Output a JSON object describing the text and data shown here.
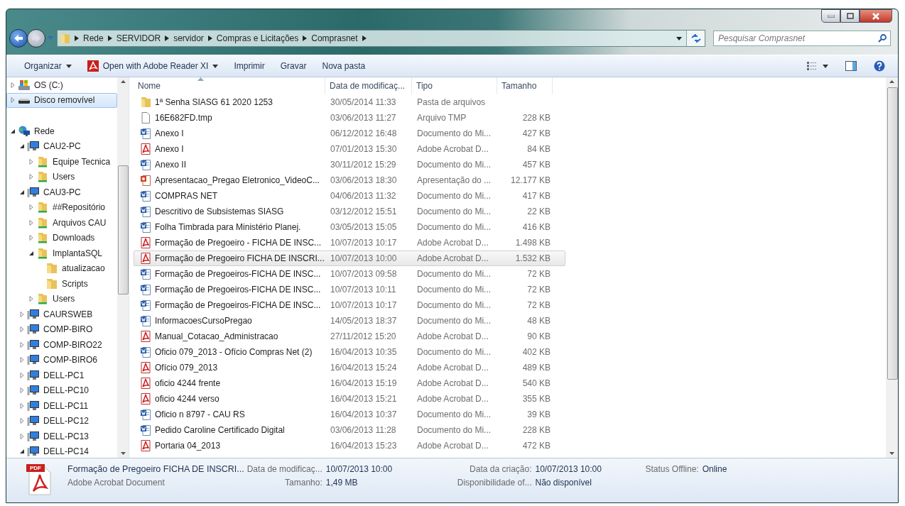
{
  "breadcrumb": [
    "Rede",
    "SERVIDOR",
    "servidor",
    "Compras e Licitações",
    "Comprasnet"
  ],
  "search": {
    "placeholder": "Pesquisar Comprasnet"
  },
  "toolbar": [
    {
      "label": "Organizar",
      "kind": "menu"
    },
    {
      "label": "Open with Adobe Reader XI",
      "kind": "pdfmenu"
    },
    {
      "label": "Imprimir",
      "kind": "plain"
    },
    {
      "label": "Gravar",
      "kind": "plain"
    },
    {
      "label": "Nova pasta",
      "kind": "plain"
    }
  ],
  "tree": [
    {
      "label": "OS (C:)",
      "kind": "drive",
      "expanded": false,
      "selected": false
    },
    {
      "label": "Disco removível",
      "kind": "usb",
      "expanded": false,
      "selected": true
    },
    {
      "label": "Rede",
      "kind": "network",
      "expanded": true,
      "selected": false,
      "children": [
        {
          "label": "CAU2-PC",
          "kind": "computer",
          "expanded": true,
          "selected": false,
          "children": [
            {
              "label": "Equipe Tecnica",
              "kind": "share",
              "expanded": false,
              "selected": false
            },
            {
              "label": "Users",
              "kind": "share",
              "expanded": false,
              "selected": false
            }
          ]
        },
        {
          "label": "CAU3-PC",
          "kind": "computer",
          "expanded": true,
          "selected": false,
          "children": [
            {
              "label": "##Repositório",
              "kind": "share",
              "expanded": false,
              "selected": false
            },
            {
              "label": "Arquivos CAU",
              "kind": "share",
              "expanded": false,
              "selected": false
            },
            {
              "label": "Downloads",
              "kind": "share",
              "expanded": false,
              "selected": false
            },
            {
              "label": "ImplantaSQL",
              "kind": "share",
              "expanded": true,
              "selected": false,
              "children": [
                {
                  "label": "atualizacao",
                  "kind": "folder",
                  "selected": false
                },
                {
                  "label": "Scripts",
                  "kind": "folder",
                  "selected": false
                }
              ]
            },
            {
              "label": "Users",
              "kind": "share",
              "expanded": false,
              "selected": false
            }
          ]
        },
        {
          "label": "CAURSWEB",
          "kind": "computer",
          "expanded": false,
          "selected": false
        },
        {
          "label": "COMP-BIRO",
          "kind": "computer",
          "expanded": false,
          "selected": false
        },
        {
          "label": "COMP-BIRO22",
          "kind": "computer",
          "expanded": false,
          "selected": false
        },
        {
          "label": "COMP-BIRO6",
          "kind": "computer",
          "expanded": false,
          "selected": false
        },
        {
          "label": "DELL-PC1",
          "kind": "computer",
          "expanded": false,
          "selected": false
        },
        {
          "label": "DELL-PC10",
          "kind": "computer",
          "expanded": false,
          "selected": false
        },
        {
          "label": "DELL-PC11",
          "kind": "computer",
          "expanded": false,
          "selected": false
        },
        {
          "label": "DELL-PC12",
          "kind": "computer",
          "expanded": false,
          "selected": false
        },
        {
          "label": "DELL-PC13",
          "kind": "computer",
          "expanded": false,
          "selected": false
        },
        {
          "label": "DELL-PC14",
          "kind": "computer",
          "expanded": true,
          "selected": false
        }
      ]
    }
  ],
  "columns": [
    "Nome",
    "Data de modificaç...",
    "Tipo",
    "Tamanho"
  ],
  "files": [
    {
      "kind": "folder",
      "name": "1ª Senha SIASG    61 2020 1253",
      "date": "30/05/2014 11:33",
      "type": "Pasta de arquivos",
      "selected": false
    },
    {
      "kind": "file",
      "name": "16E682FD.tmp",
      "date": "03/06/2013 11:27",
      "type": "Arquivo TMP",
      "size": "228 KB",
      "selected": false
    },
    {
      "kind": "word",
      "name": "Anexo I",
      "date": "06/12/2012 16:48",
      "type": "Documento do Mi...",
      "size": "427 KB",
      "selected": false
    },
    {
      "kind": "pdf",
      "name": "Anexo I",
      "date": "07/01/2013 15:30",
      "type": "Adobe Acrobat D...",
      "size": "84 KB",
      "selected": false
    },
    {
      "kind": "word",
      "name": "Anexo II",
      "date": "30/11/2012 15:29",
      "type": "Documento do Mi...",
      "size": "457 KB",
      "selected": false
    },
    {
      "kind": "ppt",
      "name": "Apresentacao_Pregao Eletronico_VideoC...",
      "date": "03/06/2013 18:30",
      "type": "Apresentação do ...",
      "size": "12.177 KB",
      "selected": false
    },
    {
      "kind": "word",
      "name": "COMPRAS NET",
      "date": "04/06/2013 11:32",
      "type": "Documento do Mi...",
      "size": "417 KB",
      "selected": false
    },
    {
      "kind": "word",
      "name": "Descritivo de Subsistemas SIASG",
      "date": "03/12/2012 15:51",
      "type": "Documento do Mi...",
      "size": "22 KB",
      "selected": false
    },
    {
      "kind": "word",
      "name": "Folha Timbrada para Ministério Planej.",
      "date": "03/05/2013 15:05",
      "type": "Documento do Mi...",
      "size": "416 KB",
      "selected": false
    },
    {
      "kind": "pdf",
      "name": "Formação de Pregoeiro - FICHA DE INSC...",
      "date": "10/07/2013 10:17",
      "type": "Adobe Acrobat D...",
      "size": "1.498 KB",
      "selected": false
    },
    {
      "kind": "pdf",
      "name": "Formação de Pregoeiro FICHA DE INSCRI...",
      "date": "10/07/2013 10:00",
      "type": "Adobe Acrobat D...",
      "size": "1.532 KB",
      "selected": true
    },
    {
      "kind": "word",
      "name": "Formação de Pregoeiros-FICHA DE INSC...",
      "date": "10/07/2013 09:58",
      "type": "Documento do Mi...",
      "size": "72 KB",
      "selected": false
    },
    {
      "kind": "word",
      "name": "Formação de Pregoeiros-FICHA DE INSC...",
      "date": "10/07/2013 10:11",
      "type": "Documento do Mi...",
      "size": "72 KB",
      "selected": false
    },
    {
      "kind": "word",
      "name": "Formação de Pregoeiros-FICHA DE INSC...",
      "date": "10/07/2013 10:17",
      "type": "Documento do Mi...",
      "size": "72 KB",
      "selected": false
    },
    {
      "kind": "word",
      "name": "InformacoesCursoPregao",
      "date": "14/05/2013 18:37",
      "type": "Documento do Mi...",
      "size": "48 KB",
      "selected": false
    },
    {
      "kind": "pdf",
      "name": "Manual_Cotacao_Administracao",
      "date": "27/11/2012 15:20",
      "type": "Adobe Acrobat D...",
      "size": "90 KB",
      "selected": false
    },
    {
      "kind": "word",
      "name": "Oficio 079_2013 - Ofício Compras Net (2)",
      "date": "16/04/2013 10:35",
      "type": "Documento do Mi...",
      "size": "402 KB",
      "selected": false
    },
    {
      "kind": "pdf",
      "name": "Ofício 079_2013",
      "date": "16/04/2013 15:24",
      "type": "Adobe Acrobat D...",
      "size": "489 KB",
      "selected": false
    },
    {
      "kind": "pdf",
      "name": "oficio 4244 frente",
      "date": "16/04/2013 15:19",
      "type": "Adobe Acrobat D...",
      "size": "540 KB",
      "selected": false
    },
    {
      "kind": "pdf",
      "name": "oficio 4244 verso",
      "date": "16/04/2013 15:21",
      "type": "Adobe Acrobat D...",
      "size": "355 KB",
      "selected": false
    },
    {
      "kind": "word",
      "name": "Oficio n 8797 - CAU RS",
      "date": "16/04/2013 10:37",
      "type": "Documento do Mi...",
      "size": "39 KB",
      "selected": false
    },
    {
      "kind": "word",
      "name": "Pedido Caroline Certificado Digital",
      "date": "03/06/2013 11:28",
      "type": "Documento do Mi...",
      "size": "228 KB",
      "selected": false
    },
    {
      "kind": "pdf",
      "name": "Portaria 04_2013",
      "date": "16/04/2013 15:23",
      "type": "Adobe Acrobat D...",
      "size": "472 KB",
      "selected": false
    }
  ],
  "details": {
    "badge": "PDF",
    "name": "Formação de Pregoeiro FICHA DE INSCRI...",
    "type": "Adobe Acrobat Document",
    "fields": [
      {
        "label": "Data de modificaç...",
        "value": "10/07/2013 10:00"
      },
      {
        "label": "Data da criação:",
        "value": "10/07/2013 10:00"
      },
      {
        "label": "Status Offline:",
        "value": "Online"
      },
      {
        "label": "Tamanho:",
        "value": "1,49 MB"
      },
      {
        "label": "Disponibilidade of...",
        "value": "Não disponível"
      }
    ]
  }
}
